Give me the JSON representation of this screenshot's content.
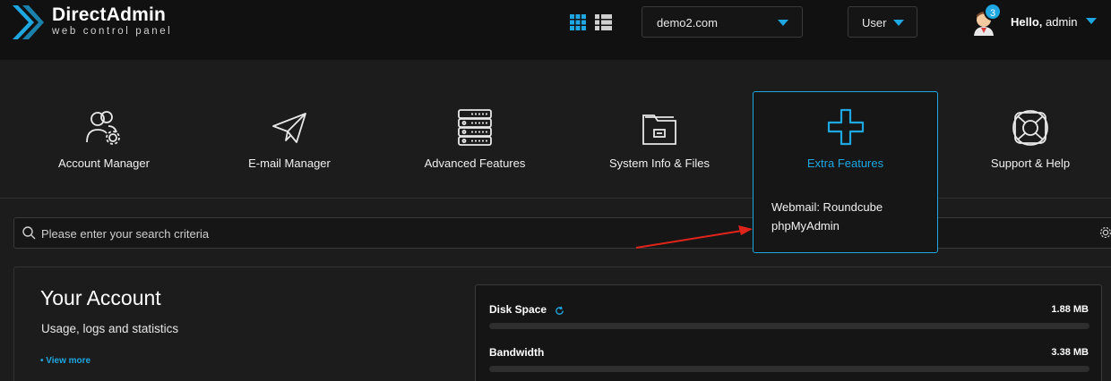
{
  "brand": {
    "title": "DirectAdmin",
    "subtitle": "web control panel",
    "accent": "#1ea7e1"
  },
  "header": {
    "domain": "demo2.com",
    "role": "User",
    "notifications": "3",
    "greeting": "Hello,",
    "username": "admin",
    "view_icons": [
      "grid-view-icon",
      "list-view-icon"
    ]
  },
  "categories": [
    {
      "label": "Account Manager",
      "icon": "users-gear-icon"
    },
    {
      "label": "E-mail Manager",
      "icon": "paper-plane-icon"
    },
    {
      "label": "Advanced Features",
      "icon": "server-icon"
    },
    {
      "label": "System Info & Files",
      "icon": "folder-icon"
    },
    {
      "label": "Extra Features",
      "icon": "plus-icon"
    },
    {
      "label": "Support & Help",
      "icon": "lifebuoy-icon"
    }
  ],
  "extra_menu": {
    "items": [
      "Webmail: Roundcube",
      "phpMyAdmin"
    ]
  },
  "search": {
    "placeholder": "Please enter your search criteria"
  },
  "account": {
    "title": "Your Account",
    "subtitle": "Usage, logs and statistics",
    "more": "• View more",
    "stats": [
      {
        "name": "Disk Space",
        "value": "1.88 MB"
      },
      {
        "name": "Bandwidth",
        "value": "3.38 MB"
      }
    ]
  }
}
